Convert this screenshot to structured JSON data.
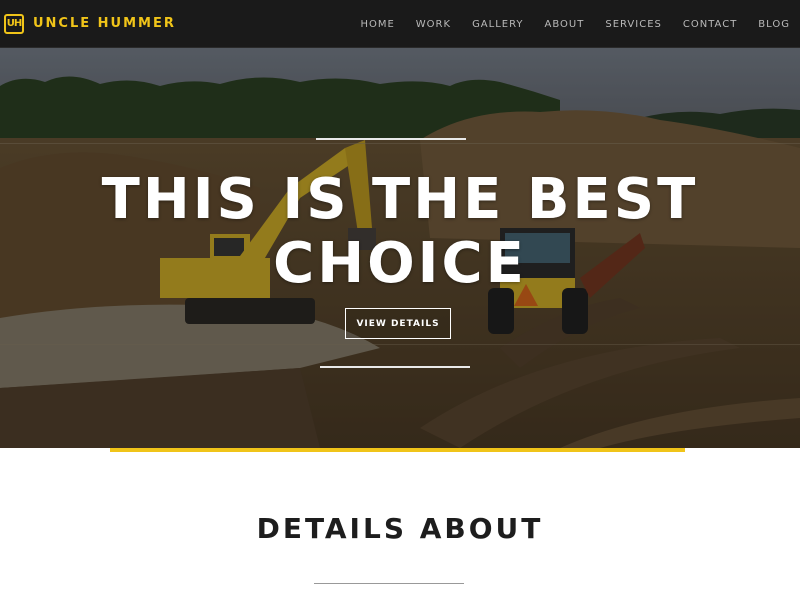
{
  "header": {
    "logo_mark": "UH",
    "logo_text": "UNCLE HUMMER",
    "nav": [
      "HOME",
      "WORK",
      "GALLERY",
      "ABOUT",
      "SERVICES",
      "CONTACT",
      "BLOG"
    ]
  },
  "hero": {
    "title": "THIS IS THE BEST CHOICE",
    "button_label": "VIEW DETAILS"
  },
  "section": {
    "title": "DETAILS ABOUT"
  },
  "colors": {
    "accent": "#f0c419",
    "header_bg": "#1a1a1a",
    "heading": "#1d1d1d"
  }
}
